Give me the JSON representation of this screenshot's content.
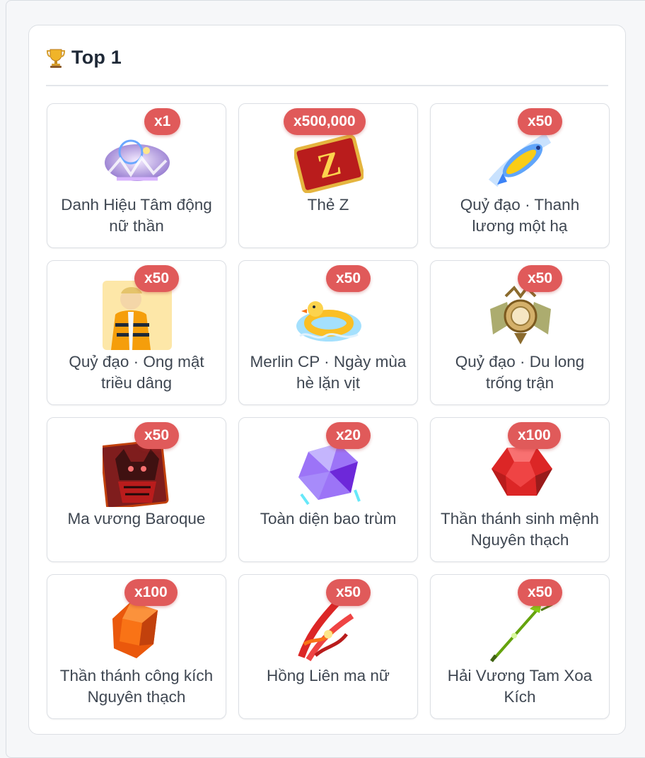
{
  "header": {
    "title": "Top 1",
    "trophy_icon": "trophy-icon"
  },
  "items": [
    {
      "name": "Danh Hiệu Tâm động nữ thần",
      "qty": "x1",
      "icon": "title-emblem-icon"
    },
    {
      "name": "Thẻ Z",
      "qty": "x500,000",
      "icon": "z-card-icon"
    },
    {
      "name": "Quỷ đạo · Thanh lương một hạ",
      "qty": "x50",
      "icon": "fish-trail-icon"
    },
    {
      "name": "Quỷ đạo · Ong mật triều dâng",
      "qty": "x50",
      "icon": "bee-character-icon"
    },
    {
      "name": "Merlin CP · Ngày mùa hè lặn vịt",
      "qty": "x50",
      "icon": "duck-float-icon"
    },
    {
      "name": "Quỷ đạo · Du long trống trận",
      "qty": "x50",
      "icon": "dragon-drum-icon"
    },
    {
      "name": "Ma vương Baroque",
      "qty": "x50",
      "icon": "demon-king-icon"
    },
    {
      "name": "Toàn diện bao trùm",
      "qty": "x20",
      "icon": "crystal-shield-icon"
    },
    {
      "name": "Thần thánh sinh mệnh Nguyên thạch",
      "qty": "x100",
      "icon": "life-gem-icon"
    },
    {
      "name": "Thần thánh công kích Nguyên thạch",
      "qty": "x100",
      "icon": "attack-gem-icon"
    },
    {
      "name": "Hồng Liên ma nữ",
      "qty": "x50",
      "icon": "flame-wings-icon"
    },
    {
      "name": "Hải Vương Tam Xoa Kích",
      "qty": "x50",
      "icon": "trident-icon"
    }
  ],
  "colors": {
    "badge": "#e05a5a",
    "card_border": "#dcdfe4",
    "text": "#3f4752",
    "title": "#1f2937"
  }
}
